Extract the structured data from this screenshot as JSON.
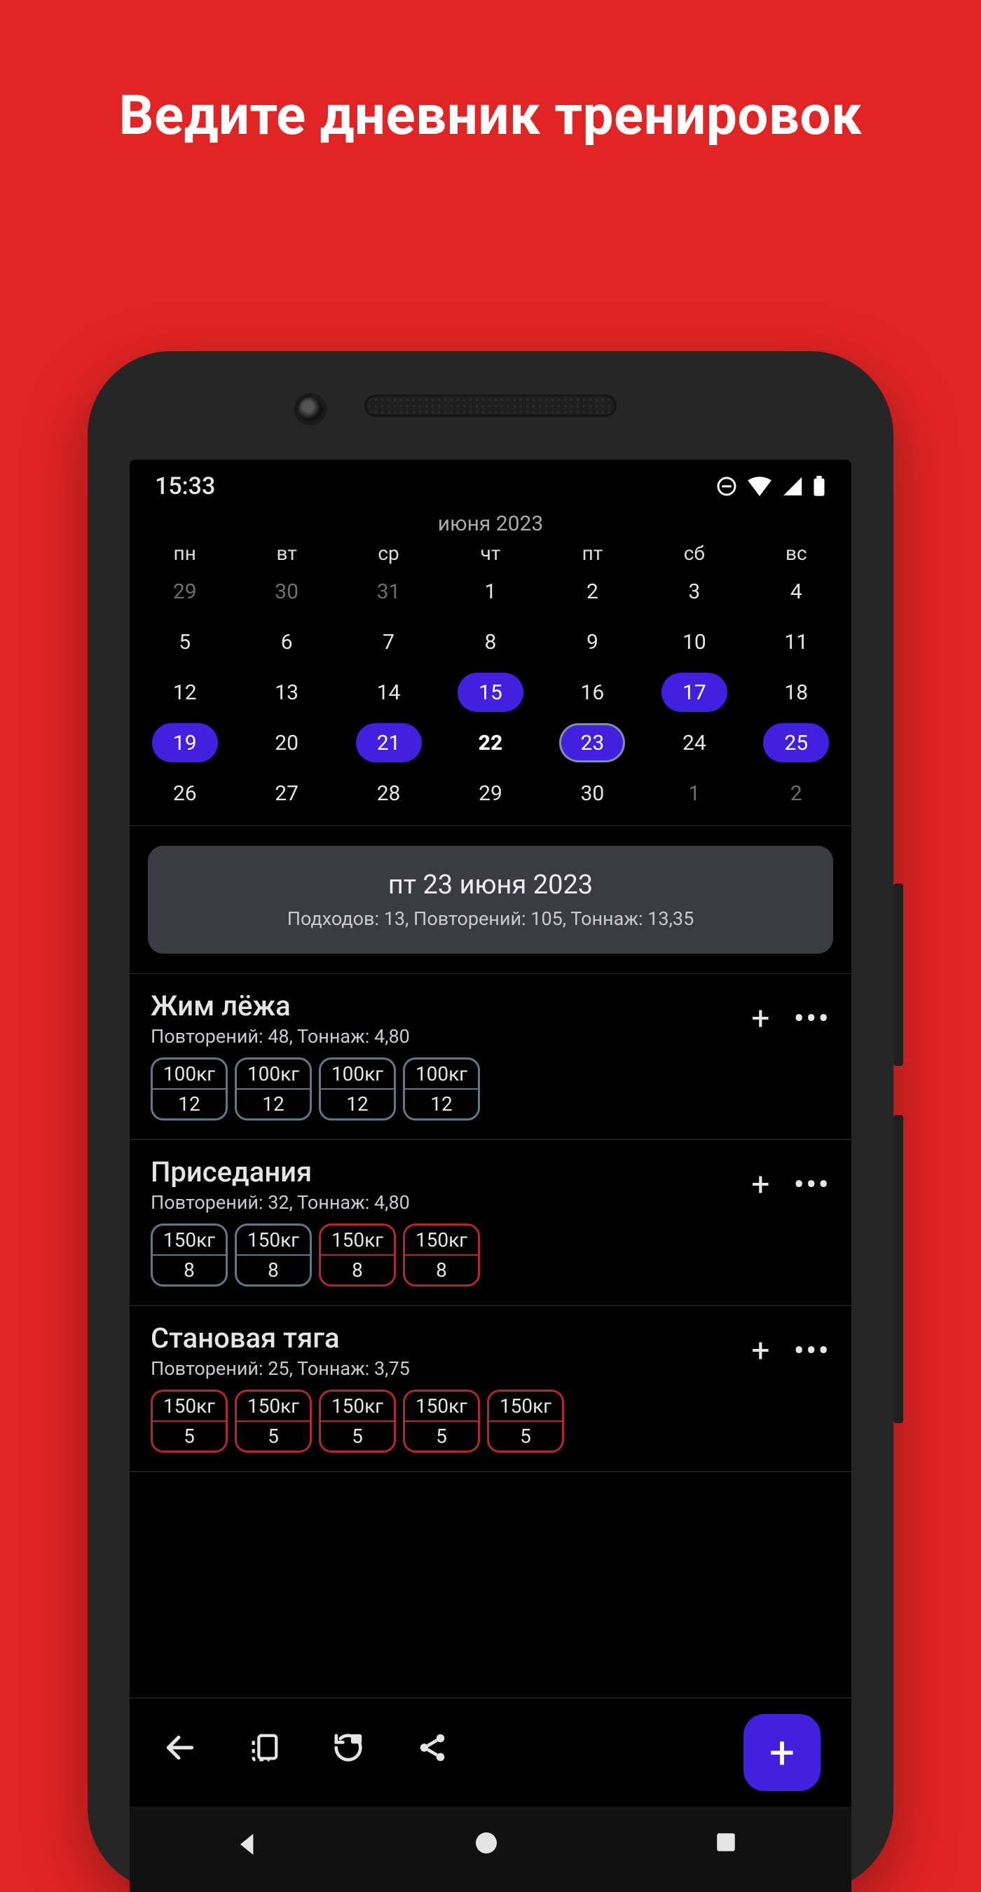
{
  "headline": "Ведите дневник тренировок",
  "statusbar": {
    "time": "15:33"
  },
  "calendar": {
    "title": "июня 2023",
    "weekdays": [
      "пн",
      "вт",
      "ср",
      "чт",
      "пт",
      "сб",
      "вс"
    ],
    "days": [
      {
        "n": "29",
        "dim": true
      },
      {
        "n": "30",
        "dim": true
      },
      {
        "n": "31",
        "dim": true
      },
      {
        "n": "1"
      },
      {
        "n": "2"
      },
      {
        "n": "3"
      },
      {
        "n": "4"
      },
      {
        "n": "5"
      },
      {
        "n": "6"
      },
      {
        "n": "7"
      },
      {
        "n": "8"
      },
      {
        "n": "9"
      },
      {
        "n": "10"
      },
      {
        "n": "11"
      },
      {
        "n": "12"
      },
      {
        "n": "13"
      },
      {
        "n": "14"
      },
      {
        "n": "15",
        "mark": true
      },
      {
        "n": "16"
      },
      {
        "n": "17",
        "mark": true
      },
      {
        "n": "18"
      },
      {
        "n": "19",
        "mark": true
      },
      {
        "n": "20"
      },
      {
        "n": "21",
        "mark": true
      },
      {
        "n": "22",
        "today": true
      },
      {
        "n": "23",
        "sel": true
      },
      {
        "n": "24"
      },
      {
        "n": "25",
        "mark": true
      },
      {
        "n": "26"
      },
      {
        "n": "27"
      },
      {
        "n": "28"
      },
      {
        "n": "29"
      },
      {
        "n": "30"
      },
      {
        "n": "1",
        "dim": true
      },
      {
        "n": "2",
        "dim": true
      }
    ]
  },
  "summary": {
    "date": "пт 23 июня 2023",
    "meta": "Подходов: 13, Повторений: 105, Тоннаж: 13,35"
  },
  "exercises": [
    {
      "name": "Жим лёжа",
      "sub": "Повторений: 48, Тоннаж: 4,80",
      "sets": [
        {
          "wt": "100кг",
          "rp": "12",
          "c": "grey"
        },
        {
          "wt": "100кг",
          "rp": "12",
          "c": "grey"
        },
        {
          "wt": "100кг",
          "rp": "12",
          "c": "grey"
        },
        {
          "wt": "100кг",
          "rp": "12",
          "c": "grey"
        }
      ]
    },
    {
      "name": "Приседания",
      "sub": "Повторений: 32, Тоннаж: 4,80",
      "sets": [
        {
          "wt": "150кг",
          "rp": "8",
          "c": "grey"
        },
        {
          "wt": "150кг",
          "rp": "8",
          "c": "grey"
        },
        {
          "wt": "150кг",
          "rp": "8",
          "c": "red"
        },
        {
          "wt": "150кг",
          "rp": "8",
          "c": "red"
        }
      ]
    },
    {
      "name": "Становая тяга",
      "sub": "Повторений: 25, Тоннаж: 3,75",
      "sets": [
        {
          "wt": "150кг",
          "rp": "5",
          "c": "red"
        },
        {
          "wt": "150кг",
          "rp": "5",
          "c": "red"
        },
        {
          "wt": "150кг",
          "rp": "5",
          "c": "red"
        },
        {
          "wt": "150кг",
          "rp": "5",
          "c": "red"
        },
        {
          "wt": "150кг",
          "rp": "5",
          "c": "red"
        }
      ]
    }
  ],
  "labels": {
    "add": "+",
    "more": "•••"
  }
}
